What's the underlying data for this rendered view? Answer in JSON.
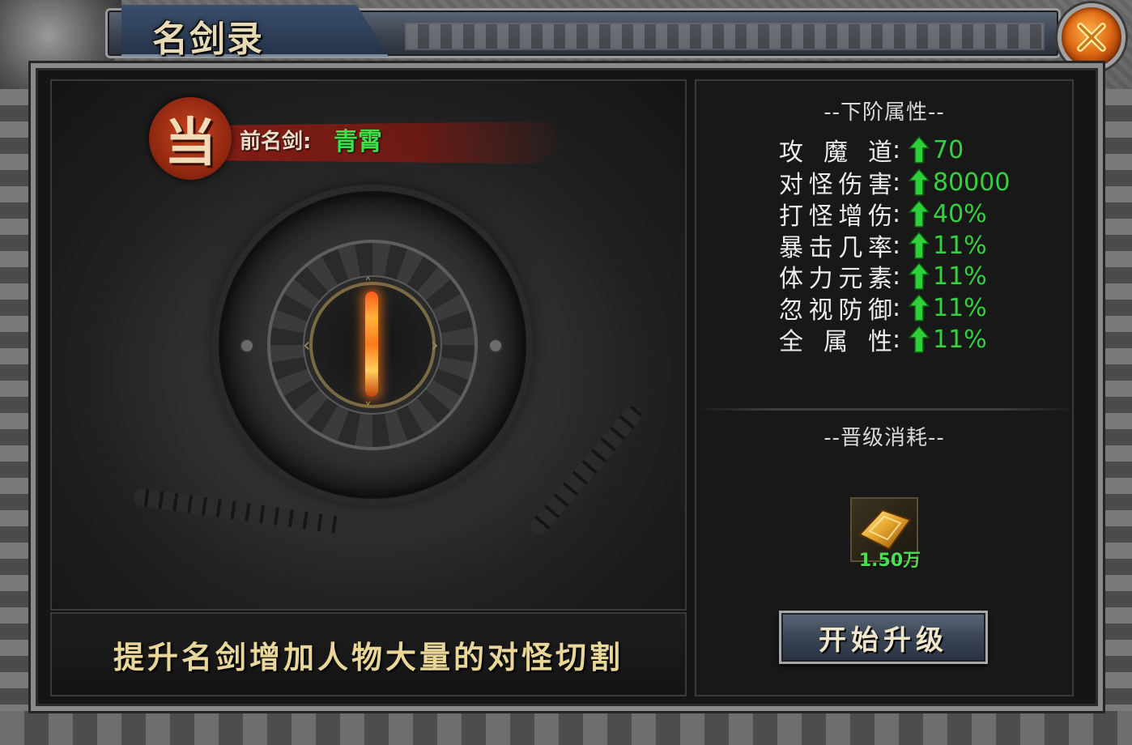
{
  "window": {
    "title": "名剑录",
    "close_icon": "close-x-icon"
  },
  "current_sword": {
    "seal_char": "当",
    "label": "前名剑:",
    "name": "青霄",
    "name_color": "#3ee04a"
  },
  "description": "提升名剑增加人物大量的对怪切割",
  "next_stage": {
    "heading": "--下阶属性--",
    "stats": [
      {
        "label": "攻魔道",
        "value": "70"
      },
      {
        "label": "对怪伤害",
        "value": "80000"
      },
      {
        "label": "打怪增伤",
        "value": "40%"
      },
      {
        "label": "暴击几率",
        "value": "11%"
      },
      {
        "label": "体力元素",
        "value": "11%"
      },
      {
        "label": "忽视防御",
        "value": "11%"
      },
      {
        "label": "全属性",
        "value": "11%"
      }
    ],
    "value_color": "#34d23e"
  },
  "upgrade_cost": {
    "heading": "--晋级消耗--",
    "item_icon": "gold-ingot-icon",
    "quantity": "1.50万"
  },
  "upgrade_button": {
    "label": "开始升级"
  }
}
